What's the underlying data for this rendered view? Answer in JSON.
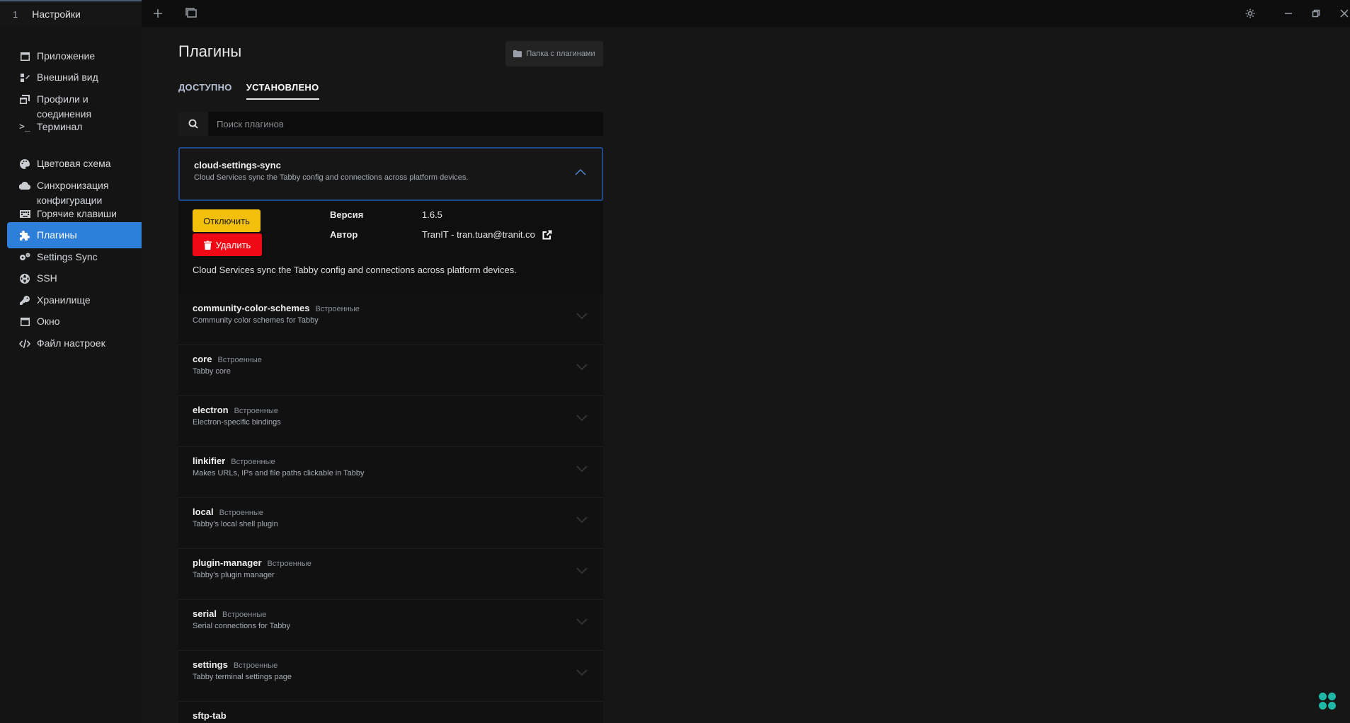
{
  "window": {
    "tab_number": "1",
    "tab_title": "Настройки"
  },
  "sidebar": {
    "items": [
      {
        "label": "Приложение",
        "icon": "window-icon"
      },
      {
        "label": "Внешний вид",
        "icon": "brush-icon"
      },
      {
        "label": "Профили и соединения",
        "icon": "window-stack-icon"
      },
      {
        "label": "Терминал",
        "icon": "terminal-icon"
      },
      {
        "label": "Цветовая схема",
        "icon": "palette-icon"
      },
      {
        "label": "Синхронизация конфигурации",
        "icon": "cloud-icon"
      },
      {
        "label": "Горячие клавиши",
        "icon": "keyboard-icon"
      },
      {
        "label": "Плагины",
        "icon": "puzzle-icon",
        "active": true
      },
      {
        "label": "Settings Sync",
        "icon": "gears-icon"
      },
      {
        "label": "SSH",
        "icon": "globe-icon"
      },
      {
        "label": "Хранилище",
        "icon": "key-icon"
      },
      {
        "label": "Окно",
        "icon": "window-icon"
      },
      {
        "label": "Файл настроек",
        "icon": "code-icon"
      }
    ]
  },
  "main": {
    "title": "Плагины",
    "folder_button": "Папка с плагинами",
    "tabs": [
      {
        "label": "ДОСТУПНО",
        "active": false
      },
      {
        "label": "УСТАНОВЛЕНО",
        "active": true
      }
    ],
    "search": {
      "placeholder": "Поиск плагинов"
    },
    "expanded_plugin": {
      "name": "cloud-settings-sync",
      "description": "Cloud Services sync the Tabby config and connections across platform devices.",
      "disable_label": "Отключить",
      "delete_label": "Удалить",
      "version_label": "Версия",
      "version": "1.6.5",
      "author_label": "Автор",
      "author": "TranIT - tran.tuan@tranit.co",
      "long_description": "Cloud Services sync the Tabby config and connections across platform devices."
    },
    "plugins": [
      {
        "name": "community-color-schemes",
        "badge": "Встроенные",
        "description": "Community color schemes for Tabby"
      },
      {
        "name": "core",
        "badge": "Встроенные",
        "description": "Tabby core"
      },
      {
        "name": "electron",
        "badge": "Встроенные",
        "description": "Electron-specific bindings"
      },
      {
        "name": "linkifier",
        "badge": "Встроенные",
        "description": "Makes URLs, IPs and file paths clickable in Tabby"
      },
      {
        "name": "local",
        "badge": "Встроенные",
        "description": "Tabby's local shell plugin"
      },
      {
        "name": "plugin-manager",
        "badge": "Встроенные",
        "description": "Tabby's plugin manager"
      },
      {
        "name": "serial",
        "badge": "Встроенные",
        "description": "Serial connections for Tabby"
      },
      {
        "name": "settings",
        "badge": "Встроенные",
        "description": "Tabby terminal settings page"
      },
      {
        "name": "sftp-tab",
        "badge": "",
        "description": ""
      }
    ]
  },
  "colors": {
    "accent": "#2e7fd9",
    "disable_button": "#f2c00a",
    "delete_button": "#ee0a14",
    "logo": "#1fb8a6"
  }
}
